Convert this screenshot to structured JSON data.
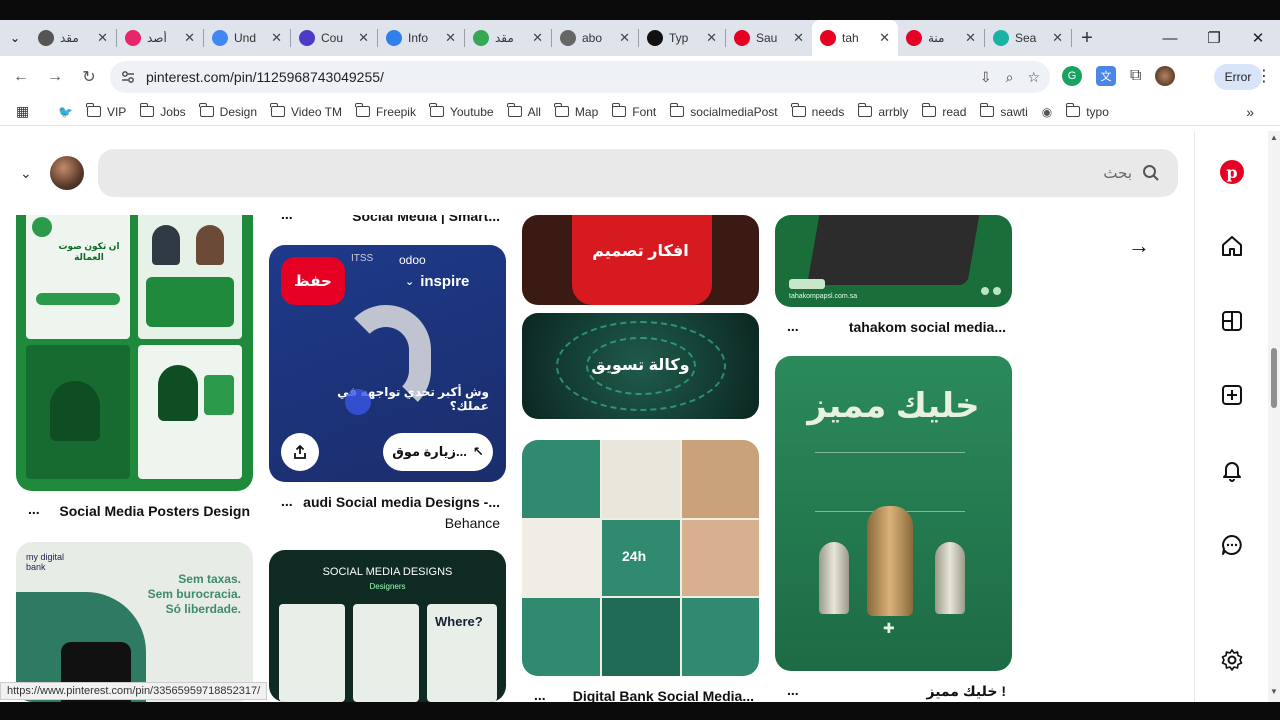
{
  "browser": {
    "tabs": [
      {
        "title": "مقد",
        "fav": "#555",
        "fav_icon": "globe-icon"
      },
      {
        "title": "أصد",
        "fav": "#e7256a",
        "fav_icon": "app-icon"
      },
      {
        "title": "Und",
        "fav": "#4285f4",
        "fav_icon": "google-icon"
      },
      {
        "title": "Cou",
        "fav": "#4b3bc6",
        "fav_icon": "course-icon"
      },
      {
        "title": "Info",
        "fav": "#2f80ed",
        "fav_icon": "info-icon"
      },
      {
        "title": "مقد",
        "fav": "#34a853",
        "fav_icon": "microsoft-icon"
      },
      {
        "title": "abo",
        "fav": "#666",
        "fav_icon": "globe-icon"
      },
      {
        "title": "Typ",
        "fav": "#111",
        "fav_icon": "d-icon"
      },
      {
        "title": "Sau",
        "fav": "#e60023",
        "fav_icon": "pinterest-icon"
      },
      {
        "title": "tah",
        "fav": "#e60023",
        "fav_icon": "pinterest-icon",
        "active": true
      },
      {
        "title": "منة",
        "fav": "#e60023",
        "fav_icon": "pinterest-icon"
      },
      {
        "title": "Sea",
        "fav": "#19b3a6",
        "fav_icon": "v-icon"
      }
    ],
    "url": "pinterest.com/pin/1125968743049255/",
    "error_label": "Error",
    "bookmarks": [
      {
        "label": "",
        "kind": "twitter"
      },
      {
        "label": "VIP",
        "kind": "folder"
      },
      {
        "label": "Jobs",
        "kind": "folder"
      },
      {
        "label": "Design",
        "kind": "folder"
      },
      {
        "label": "Video TM",
        "kind": "folder"
      },
      {
        "label": "Freepik",
        "kind": "folder"
      },
      {
        "label": "Youtube",
        "kind": "folder"
      },
      {
        "label": "All",
        "kind": "folder"
      },
      {
        "label": "Map",
        "kind": "folder"
      },
      {
        "label": "Font",
        "kind": "folder"
      },
      {
        "label": "socialmediaPost",
        "kind": "folder"
      },
      {
        "label": "needs",
        "kind": "folder"
      },
      {
        "label": "arrbly",
        "kind": "folder"
      },
      {
        "label": "read",
        "kind": "folder"
      },
      {
        "label": "sawti",
        "kind": "folder"
      },
      {
        "label": "",
        "kind": "globe"
      },
      {
        "label": "typo",
        "kind": "folder"
      }
    ]
  },
  "header": {
    "search_placeholder": "بحث"
  },
  "pins": {
    "col1_top_caption": "Social Media Posters Design",
    "col2_top_caption": "Social Media | Smart...",
    "col2_save": "حفظ",
    "col2_inspire": "inspire",
    "col2_brand1": "ITSS",
    "col2_brand2": "odoo",
    "col2_text": "وش أكبر تحدي تواجهه في عملك؟",
    "col2_visit": "زيارة موق...",
    "col2_caption_line1": "audi Social media Designs -...",
    "col2_caption_line2": "Behance",
    "col2_bottom_title": "SOCIAL MEDIA DESIGNS",
    "col2_bottom_sub": "Designers",
    "col2_where": "Where?",
    "col3_top_text": "افكار تصميم",
    "col3_mid_text": "وكالة تسويق",
    "col3_caption": "Digital Bank Social Media...",
    "col3_time": "24h",
    "col4_top_caption": "tahakom social media...",
    "col4_site": "tahakompapsl.com.sa",
    "col4_big_title": "خليك مميز",
    "col4_caption": "خليك مميز !",
    "col1_bank_line1": "Sem taxas.",
    "col1_bank_line2": "Sem burocracia.",
    "col1_bank_line3": "Só liberdade.",
    "col1_bank_brand": "my digital bank",
    "col1_headline": "ان تكون صوت العمالة",
    "dots": "..."
  },
  "status_url": "https://www.pinterest.com/pin/33565959718852317/"
}
